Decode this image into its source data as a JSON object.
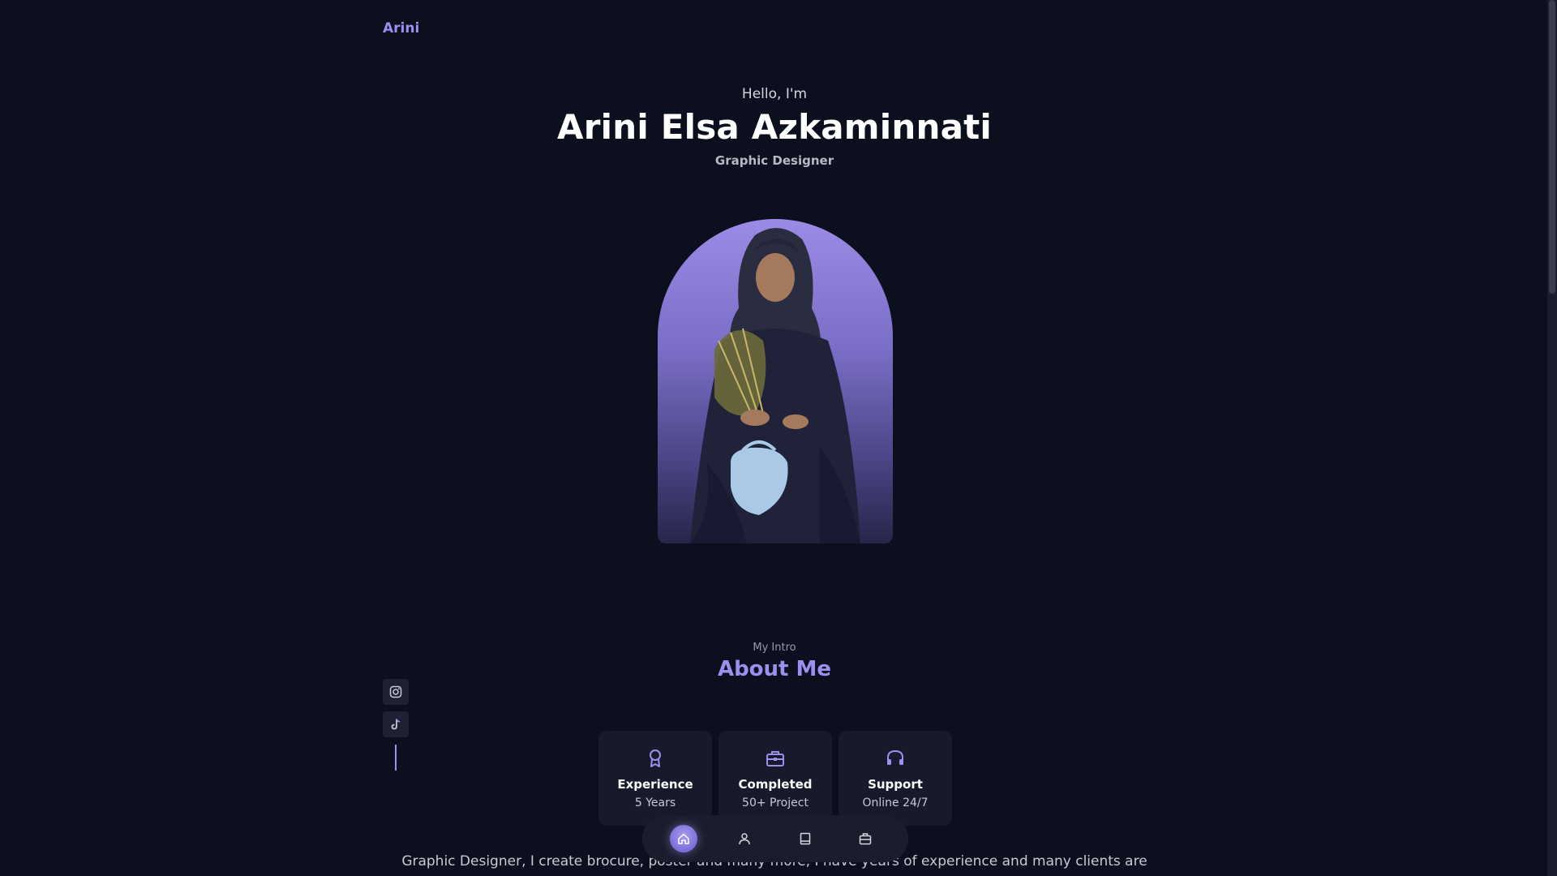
{
  "header": {
    "logo": "Arini"
  },
  "hero": {
    "greeting": "Hello, I'm",
    "name": "Arini Elsa Azkaminnati",
    "role": "Graphic Designer",
    "photo_alt": "Profile photo"
  },
  "social": [
    {
      "icon": "instagram-icon"
    },
    {
      "icon": "tiktok-icon"
    }
  ],
  "about": {
    "label": "My Intro",
    "title": "About Me",
    "cards": [
      {
        "icon": "award-icon",
        "title": "Experience",
        "subtitle": "5 Years"
      },
      {
        "icon": "briefcase-icon",
        "title": "Completed",
        "subtitle": "50+ Project"
      },
      {
        "icon": "headset-icon",
        "title": "Support",
        "subtitle": "Online 24/7"
      }
    ],
    "text": "Graphic Designer, I create brocure, poster and many more, I have years of experience and many clients are"
  },
  "nav": [
    {
      "icon": "home-icon",
      "active": true
    },
    {
      "icon": "user-icon",
      "active": false
    },
    {
      "icon": "book-icon",
      "active": false
    },
    {
      "icon": "briefcase-icon",
      "active": false
    }
  ],
  "colors": {
    "background": "#0c0f1d",
    "accent": "#9d8ff0",
    "card": "#171a2a"
  }
}
